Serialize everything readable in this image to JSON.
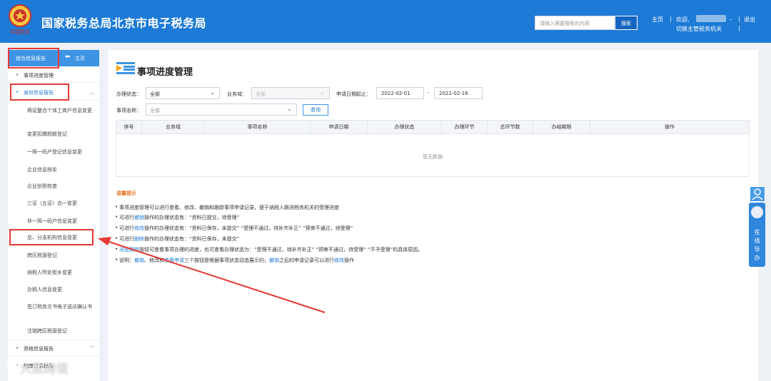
{
  "header": {
    "site_title": "国家税务总局北京市电子税务局",
    "emblem_caption": "中国税务",
    "search_placeholder": "请输入需要搜索的内容",
    "search_button": "搜索",
    "nav_home": "主页",
    "nav_welcome": "欢迎,",
    "nav_switch": "切换主管税务机关",
    "nav_exit": "退出",
    "separator": "|",
    "ellipsis": ".."
  },
  "sidebar": {
    "title": "综合信息报告",
    "home": "主页",
    "home_icon": "back-arrow-icon",
    "top_items": [
      "事项进度管理",
      "身份信息报告"
    ],
    "sub_items": [
      "两证整合个体工商户信息变更",
      "变更扣缴税款登记",
      "一照一码户登记信息变更",
      "企业信息核实",
      "企业划型核查",
      "三证（五证）合一变更",
      "非一照一码户信息变更",
      "总、分支机构信息变更",
      "跨区税源登记",
      "纳税人所处街乡变更",
      "办税人信息变更",
      "签订税务文书电子送达确认书",
      "注销跨区税源登记"
    ],
    "bottom_items": [
      "资格信息报告",
      "制度信息报告"
    ]
  },
  "main": {
    "page_title": "事项进度管理",
    "filters": {
      "status_label": "办理状态：",
      "status_value": "全部",
      "domain_label": "业务域：",
      "domain_value": "全部",
      "date_label": "申请日期起止：",
      "date_start": "2022-02-01",
      "date_sep": "-",
      "date_end": "2022-02-16",
      "item_label": "事项名称：",
      "item_value": "全部",
      "query_button": "查询"
    },
    "table": {
      "columns": [
        "序号",
        "业务域",
        "事项名称",
        "申请日期",
        "办理状态",
        "办理环节",
        "总环节数",
        "办结期限",
        "操作"
      ],
      "empty_text": "暂无数据"
    },
    "tips": {
      "title": "温馨提示",
      "lines": [
        [
          "事项进度管理可以进行查看、修改、撤销和跟踪事项申请记录，便于纳税人跟进税务机关的受理进度"
        ],
        [
          "可进行",
          "撤销",
          "操作的办理状态有：“资料已提交，待受理”"
        ],
        [
          "可进行",
          "修改",
          "操作的办理状态有：“资料已保存，未提交” “受理不通过，待补齐补正” “预审不通过，待受理”"
        ],
        [
          "可进行",
          "删除",
          "操作的办理状态有：“资料已保存，未提交”"
        ],
        [
          "",
          "进度跟踪",
          "按钮可查看事项办理的进度，也可查看办理状态为：“受理不通过，待补齐补正” “预审不通过，待受理” “不予受理”的具体原因。"
        ],
        [
          "说明：",
          "撤销",
          "、修改和",
          "查看申请",
          "三个按钮是根据事项状态动态展示的，",
          "撤销",
          "之后的申请记录可以进行",
          "修改",
          "操作"
        ]
      ]
    }
  },
  "online_service": {
    "label": "在线导办",
    "avatar_icon": "user-icon",
    "agent_icon": "agent-icon"
  },
  "watermark": "大数跨境",
  "colors": {
    "header_blue": "#1d7ad6",
    "sidebar_accent": "#3d94e5",
    "highlight_red": "#e53935",
    "tips_orange": "#e8792a"
  }
}
